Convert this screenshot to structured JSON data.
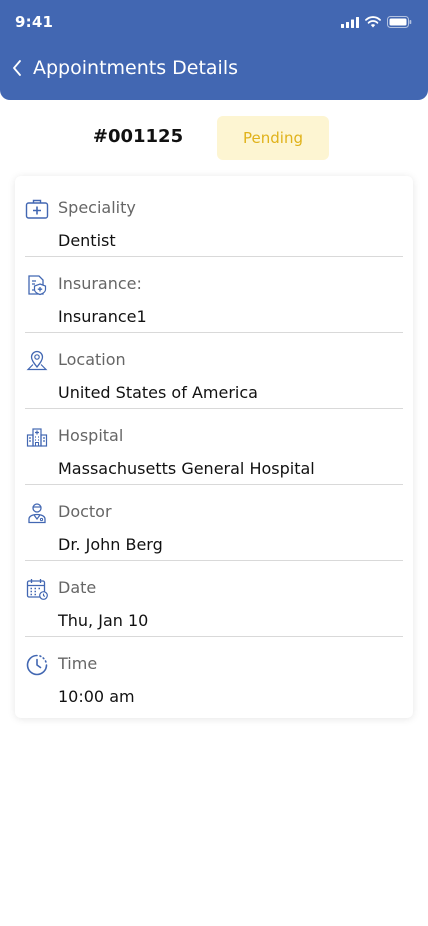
{
  "status_bar": {
    "time": "9:41"
  },
  "header": {
    "title": "Appointments Details"
  },
  "appointment": {
    "id": "#001125",
    "status": "Pending"
  },
  "details": [
    {
      "icon": "medical-kit-icon",
      "label": "Speciality",
      "value": "Dentist"
    },
    {
      "icon": "insurance-icon",
      "label": "Insurance:",
      "value": "Insurance1"
    },
    {
      "icon": "location-icon",
      "label": "Location",
      "value": "United States of America"
    },
    {
      "icon": "hospital-icon",
      "label": "Hospital",
      "value": "Massachusetts General Hospital"
    },
    {
      "icon": "doctor-icon",
      "label": "Doctor",
      "value": "Dr. John Berg"
    },
    {
      "icon": "calendar-icon",
      "label": "Date",
      "value": "Thu, Jan 10"
    },
    {
      "icon": "clock-icon",
      "label": "Time",
      "value": "10:00 am"
    }
  ],
  "colors": {
    "primary": "#4267b2",
    "pending_bg": "#fdf5d2",
    "pending_text": "#e0b21a"
  }
}
